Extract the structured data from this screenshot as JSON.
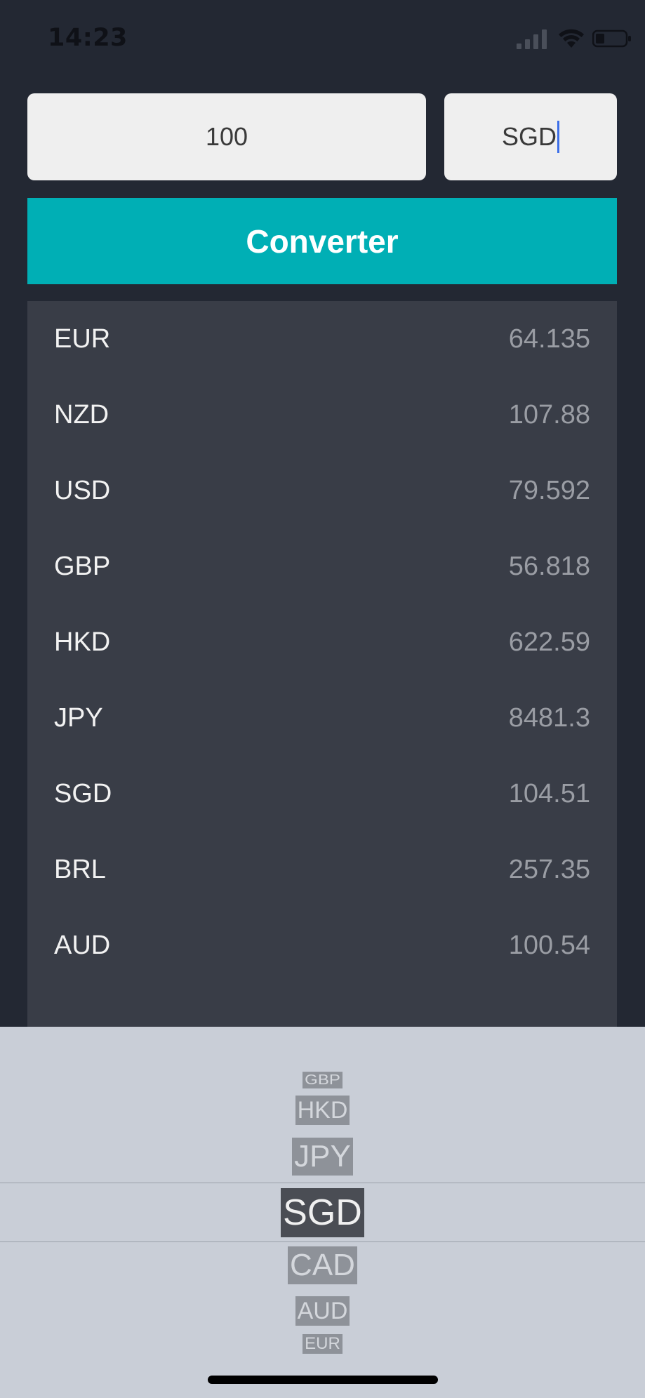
{
  "status_bar": {
    "time": "14:23"
  },
  "form": {
    "amount_value": "100",
    "currency_value": "SGD",
    "convert_label": "Converter"
  },
  "rates": [
    {
      "code": "EUR",
      "value": "64.135"
    },
    {
      "code": "NZD",
      "value": "107.88"
    },
    {
      "code": "USD",
      "value": "79.592"
    },
    {
      "code": "GBP",
      "value": "56.818"
    },
    {
      "code": "HKD",
      "value": "622.59"
    },
    {
      "code": "JPY",
      "value": "8481.3"
    },
    {
      "code": "SGD",
      "value": "104.51"
    },
    {
      "code": "BRL",
      "value": "257.35"
    },
    {
      "code": "AUD",
      "value": "100.54"
    }
  ],
  "picker": {
    "items": [
      "GBP",
      "HKD",
      "JPY",
      "SGD",
      "CAD",
      "AUD",
      "EUR"
    ],
    "selected": "SGD"
  },
  "colors": {
    "background": "#232833",
    "accent": "#00afb5",
    "panel": "#393d47",
    "picker_bg": "#c9ced7"
  }
}
